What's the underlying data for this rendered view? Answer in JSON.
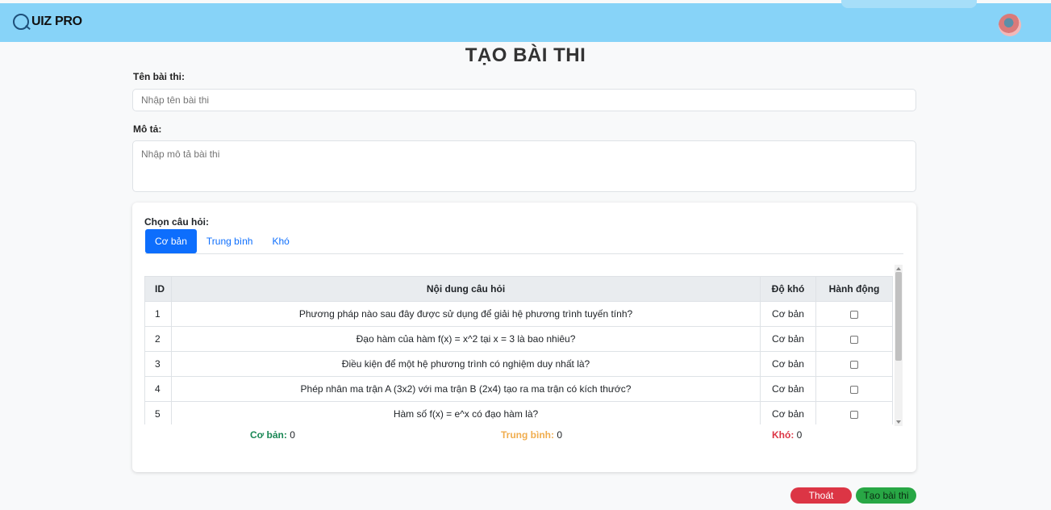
{
  "header": {
    "logo_text": "UIZ PRO",
    "logo_icon": "q-circle-icon",
    "avatar_icon": "user-avatar"
  },
  "page_title": "TẠO BÀI THI",
  "form": {
    "name_label": "Tên bài thi:",
    "name_placeholder": "Nhập tên bài thi",
    "desc_label": "Mô tả:",
    "desc_placeholder": "Nhập mô tả bài thi"
  },
  "question_picker": {
    "label": "Chọn câu hỏi:",
    "tabs": [
      {
        "label": "Cơ bản",
        "active": true
      },
      {
        "label": "Trung bình",
        "active": false
      },
      {
        "label": "Khó",
        "active": false
      }
    ],
    "columns": [
      "ID",
      "Nội dung câu hỏi",
      "Độ khó",
      "Hành động"
    ],
    "rows": [
      {
        "id": "1",
        "question": "Phương pháp nào sau đây được sử dụng để giải hệ phương trình tuyến tính?",
        "difficulty": "Cơ bản",
        "checked": false
      },
      {
        "id": "2",
        "question": "Đạo hàm của hàm f(x) = x^2 tại x = 3 là bao nhiêu?",
        "difficulty": "Cơ bản",
        "checked": false
      },
      {
        "id": "3",
        "question": "Điều kiện để một hệ phương trình có nghiệm duy nhất là?",
        "difficulty": "Cơ bản",
        "checked": false
      },
      {
        "id": "4",
        "question": "Phép nhân ma trận A (3x2) với ma trận B (2x4) tạo ra ma trận có kích thước?",
        "difficulty": "Cơ bản",
        "checked": false
      },
      {
        "id": "5",
        "question": "Hàm số f(x) = e^x có đạo hàm là?",
        "difficulty": "Cơ bản",
        "checked": false
      }
    ],
    "counts": {
      "basic_label": "Cơ bản:",
      "basic_value": "0",
      "medium_label": "Trung bình:",
      "medium_value": "0",
      "hard_label": "Khó:",
      "hard_value": "0"
    }
  },
  "actions": {
    "exit_label": "Thoát",
    "create_label": "Tạo bài thi"
  },
  "colors": {
    "header_bg": "#87d3f8",
    "primary": "#0d6efd",
    "basic": "#198754",
    "medium": "#f0ad4e",
    "hard": "#dc3545",
    "exit_bg": "#dc3545",
    "create_bg": "#28a745"
  }
}
